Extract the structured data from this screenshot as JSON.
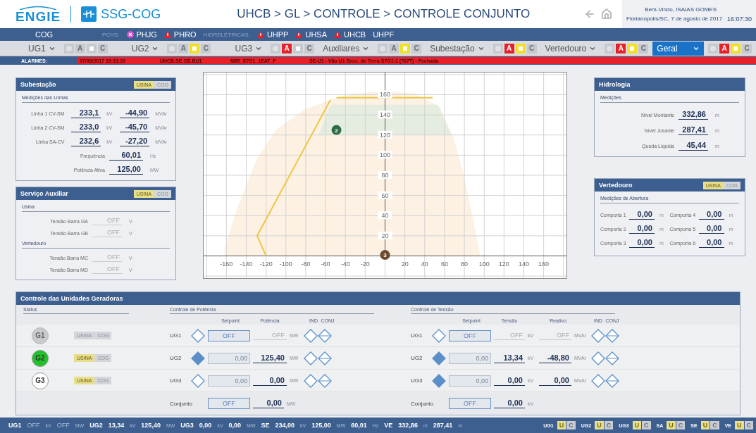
{
  "header": {
    "logo": "ENGIE",
    "app_name": "SSG-COG",
    "breadcrumb": "UHCB > GL > CONTROLE > CONTROLE CONJUNTO",
    "welcome": "Bem-Vindo, ISAIAS GOMES",
    "location_date": "Florianópolis/SC, 7 de agosto de 2017",
    "time": "16:07:30"
  },
  "nav": [
    {
      "kind": "link",
      "label": "COG"
    },
    {
      "kind": "group",
      "label": "PCHS:"
    },
    {
      "kind": "plant",
      "label": "PHJG",
      "blocked": true,
      "alarm": false
    },
    {
      "kind": "plant",
      "label": "PHRO",
      "blocked": false,
      "alarm": true
    },
    {
      "kind": "group",
      "label": "HIDRELÉTRICAS:"
    },
    {
      "kind": "plant",
      "label": "UHPP",
      "blocked": false,
      "alarm": true
    },
    {
      "kind": "plant",
      "label": "UHSA",
      "blocked": false,
      "alarm": true
    },
    {
      "kind": "plant",
      "label": "UHCB",
      "blocked": false,
      "alarm": true
    },
    {
      "kind": "plant",
      "label": "UHPF",
      "blocked": false,
      "alarm": false
    }
  ],
  "toolbar": [
    {
      "label": "UG1",
      "selected": false,
      "alarm": false,
      "warning": false,
      "alarm_label": "A",
      "cog_label": "C"
    },
    {
      "label": "UG2",
      "selected": false,
      "alarm": false,
      "warning": true,
      "alarm_label": "A",
      "cog_label": "C"
    },
    {
      "label": "UG3",
      "selected": false,
      "alarm": true,
      "warning": false,
      "alarm_label": "A",
      "cog_label": "C"
    },
    {
      "label": "Auxiliares",
      "selected": false,
      "alarm": false,
      "warning": true,
      "alarm_label": "A",
      "cog_label": "C"
    },
    {
      "label": "Subestação",
      "selected": false,
      "alarm": true,
      "warning": true,
      "alarm_label": "A",
      "cog_label": "C"
    },
    {
      "label": "Vertedouro",
      "selected": false,
      "alarm": true,
      "warning": true,
      "alarm_label": "A",
      "cog_label": "C"
    },
    {
      "label": "Geral",
      "selected": true,
      "alarm": true,
      "warning": true,
      "alarm_label": "A",
      "cog_label": "C"
    }
  ],
  "alarms": {
    "label": "ALARMES:",
    "time": "07/08/2017 15:33:20",
    "point": "UHCB.SE.CB.BU1",
    "tag": "M85_S7G1_1EAT_F",
    "description": "SE-U1 - Vão U1 Secc. de Terra S7G1-1 (767T) - Fechada"
  },
  "substation": {
    "title": "Subestação",
    "usina": "USINA",
    "cog": "COG",
    "usina_on": true,
    "section": "Medições das Linhas",
    "lines": [
      {
        "name": "Linha 1 CV-SM",
        "voltage": "233,1",
        "voltage_unit": "kV",
        "reactive": "-44,90",
        "reactive_unit": "MVAr"
      },
      {
        "name": "Linha 2 CV-SM",
        "voltage": "233,0",
        "voltage_unit": "kV",
        "reactive": "-45,70",
        "reactive_unit": "MVAr"
      },
      {
        "name": "Linha SA-CV",
        "voltage": "232,6",
        "voltage_unit": "kV",
        "reactive": "-27,20",
        "reactive_unit": "MVAr"
      }
    ],
    "readings": [
      {
        "label": "Frequência",
        "value": "60,01",
        "unit": "Hz"
      },
      {
        "label": "Potência Ativa",
        "value": "125,00",
        "unit": "MW"
      }
    ]
  },
  "auxiliary": {
    "title": "Serviço Auxiliar",
    "usina": "USINA",
    "cog": "COG",
    "usina_on": true,
    "sections": [
      {
        "title": "Usina",
        "readings": [
          {
            "label": "Tensão Barra GA",
            "value": "OFF",
            "unit": "V",
            "off": true
          },
          {
            "label": "Tensão Barra GB",
            "value": "OFF",
            "unit": "V",
            "off": true
          }
        ]
      },
      {
        "title": "Vertedouro",
        "readings": [
          {
            "label": "Tensão Barra MC",
            "value": "OFF",
            "unit": "V",
            "off": true
          },
          {
            "label": "Tensão Barra MD",
            "value": "OFF",
            "unit": "V",
            "off": true
          }
        ]
      }
    ]
  },
  "capability": {
    "chart_data": {
      "type": "line",
      "grid": true,
      "xlim": [
        -183,
        183
      ],
      "ylim": [
        -22,
        182
      ],
      "xticks": [
        -160,
        -140,
        -120,
        -100,
        -80,
        -60,
        -40,
        -20,
        20,
        40,
        60,
        80,
        100,
        120,
        140,
        160
      ],
      "yticks": [
        20,
        40,
        60,
        80,
        100,
        120,
        140,
        160
      ],
      "series": [
        {
          "type": "area",
          "color": "#fdf1e3",
          "x": [
            -162,
            -162,
            -150,
            -130,
            -110,
            -80,
            -40,
            0,
            30,
            55,
            70,
            82,
            90,
            96
          ],
          "values": [
            0,
            8,
            45,
            95,
            125,
            146,
            160,
            164,
            161,
            148,
            115,
            70,
            30,
            0
          ]
        },
        {
          "type": "area",
          "color": "#e4ede0",
          "x": [
            -67,
            -55,
            53,
            67
          ],
          "values": [
            120,
            150,
            150,
            120
          ]
        },
        {
          "type": "line",
          "color": "#eec643",
          "x": [
            -120,
            -129,
            -55
          ],
          "values": [
            0,
            20,
            155
          ]
        },
        {
          "type": "line",
          "color": "#eec643",
          "x": [
            -49,
            48
          ],
          "values": [
            157,
            157
          ]
        }
      ],
      "annotations": [
        {
          "text": "2",
          "x": -49,
          "y": 125
        },
        {
          "text": "3",
          "x": 0,
          "y": 1
        }
      ]
    },
    "markers": [
      {
        "color": "#2f6b45"
      },
      {
        "color": "#6b4a2d"
      }
    ]
  },
  "hydrology": {
    "title": "Hidrologia",
    "section": "Medições",
    "readings": [
      {
        "label": "Nível Montante",
        "value": "332,86",
        "unit": "m"
      },
      {
        "label": "Nível Jusante",
        "value": "287,41",
        "unit": "m"
      },
      {
        "label": "Queda Líquida",
        "value": "45,44",
        "unit": "m"
      }
    ]
  },
  "spillway": {
    "title": "Vertedouro",
    "usina": "USINA",
    "cog": "COG",
    "usina_on": true,
    "section": "Medições de Abertura",
    "gates": [
      {
        "label": "Comporta 1",
        "value": "0,00",
        "unit": "m"
      },
      {
        "label": "Comporta 2",
        "value": "0,00",
        "unit": "m"
      },
      {
        "label": "Comporta 3",
        "value": "0,00",
        "unit": "m"
      },
      {
        "label": "Comporta 4",
        "value": "0,00",
        "unit": "m"
      },
      {
        "label": "Comporta 5",
        "value": "0,00",
        "unit": "m"
      },
      {
        "label": "Comporta 6",
        "value": "0,00",
        "unit": "m"
      }
    ]
  },
  "control": {
    "title": "Controle das Unidades Geradoras",
    "status": {
      "title": "Status",
      "units": [
        {
          "label": "G1",
          "available": false,
          "running": false,
          "usina": "USINA",
          "cog": "COG",
          "usina_on": false
        },
        {
          "label": "G2",
          "available": true,
          "running": true,
          "usina": "USINA",
          "cog": "COG",
          "usina_on": true
        },
        {
          "label": "G3",
          "available": true,
          "running": false,
          "usina": "USINA",
          "cog": "COG",
          "usina_on": true
        }
      ]
    },
    "power": {
      "title": "Controle de Potência",
      "setpoint_header": "Setpoint",
      "value_header": "Potência",
      "ind_header": "IND",
      "conj_header": "CONJ",
      "rows": [
        {
          "label": "UG1",
          "filled": false,
          "setpoint": "OFF",
          "value": "OFF",
          "unit": "MW",
          "off": true
        },
        {
          "label": "UG2",
          "filled": true,
          "setpoint": "0,00",
          "value": "125,40",
          "unit": "MW",
          "off": false
        },
        {
          "label": "UG3",
          "filled": false,
          "setpoint": "0,00",
          "value": "0,00",
          "unit": "MW",
          "off": false
        }
      ],
      "total": {
        "label": "Conjunto",
        "setpoint": "OFF",
        "value": "0,00",
        "unit": "MW"
      }
    },
    "voltage": {
      "title": "Controle de Tensão",
      "setpoint_header": "Setpoint",
      "value_header": "Tensão",
      "reactive_header": "Reativo",
      "ind_header": "IND",
      "conj_header": "CONJ",
      "rows": [
        {
          "label": "UG1",
          "filled": false,
          "setpoint": "OFF",
          "value": "OFF",
          "unit": "kV",
          "reactive": "OFF",
          "reactive_unit": "MVAr",
          "off": true
        },
        {
          "label": "UG2",
          "filled": true,
          "setpoint": "0,00",
          "value": "13,34",
          "unit": "kV",
          "reactive": "-48,80",
          "reactive_unit": "MVAr",
          "off": false
        },
        {
          "label": "UG3",
          "filled": true,
          "setpoint": "0,00",
          "value": "0,00",
          "unit": "kV",
          "reactive": "0,00",
          "reactive_unit": "MVAr",
          "off": false
        }
      ],
      "total": {
        "label": "Conjunto",
        "setpoint": "OFF",
        "value": "0,00",
        "unit": "kV"
      }
    }
  },
  "status_bar": {
    "groups": [
      {
        "label": "UG1",
        "readings": [
          {
            "value": "OFF",
            "unit": "kV",
            "off": true
          },
          {
            "value": "OFF",
            "unit": "MW",
            "off": true
          }
        ]
      },
      {
        "label": "UG2",
        "readings": [
          {
            "value": "13,34",
            "unit": "kV",
            "off": false
          },
          {
            "value": "125,40",
            "unit": "MW",
            "off": false
          }
        ]
      },
      {
        "label": "UG3",
        "readings": [
          {
            "value": "0,00",
            "unit": "kV",
            "off": false
          },
          {
            "value": "0,00",
            "unit": "MW",
            "off": false
          }
        ]
      },
      {
        "label": "SE",
        "readings": [
          {
            "value": "234,00",
            "unit": "kV",
            "off": false
          },
          {
            "value": "125,00",
            "unit": "MW",
            "off": false
          },
          {
            "value": "60,01",
            "unit": "Hz",
            "off": false
          }
        ]
      },
      {
        "label": "VE",
        "readings": [
          {
            "value": "332,86",
            "unit": "m",
            "off": false
          },
          {
            "value": "287,41",
            "unit": "m",
            "off": false
          }
        ]
      }
    ],
    "modes": [
      {
        "label": "UG1",
        "u": "U",
        "c": "C",
        "usina_on": true
      },
      {
        "label": "UG2",
        "u": "U",
        "c": "C",
        "usina_on": true
      },
      {
        "label": "UG3",
        "u": "U",
        "c": "C",
        "usina_on": true
      },
      {
        "label": "SA",
        "u": "U",
        "c": "C",
        "usina_on": true
      },
      {
        "label": "SE",
        "u": "U",
        "c": "C",
        "usina_on": true
      },
      {
        "label": "VE",
        "u": "U",
        "c": "C",
        "usina_on": true
      }
    ]
  }
}
